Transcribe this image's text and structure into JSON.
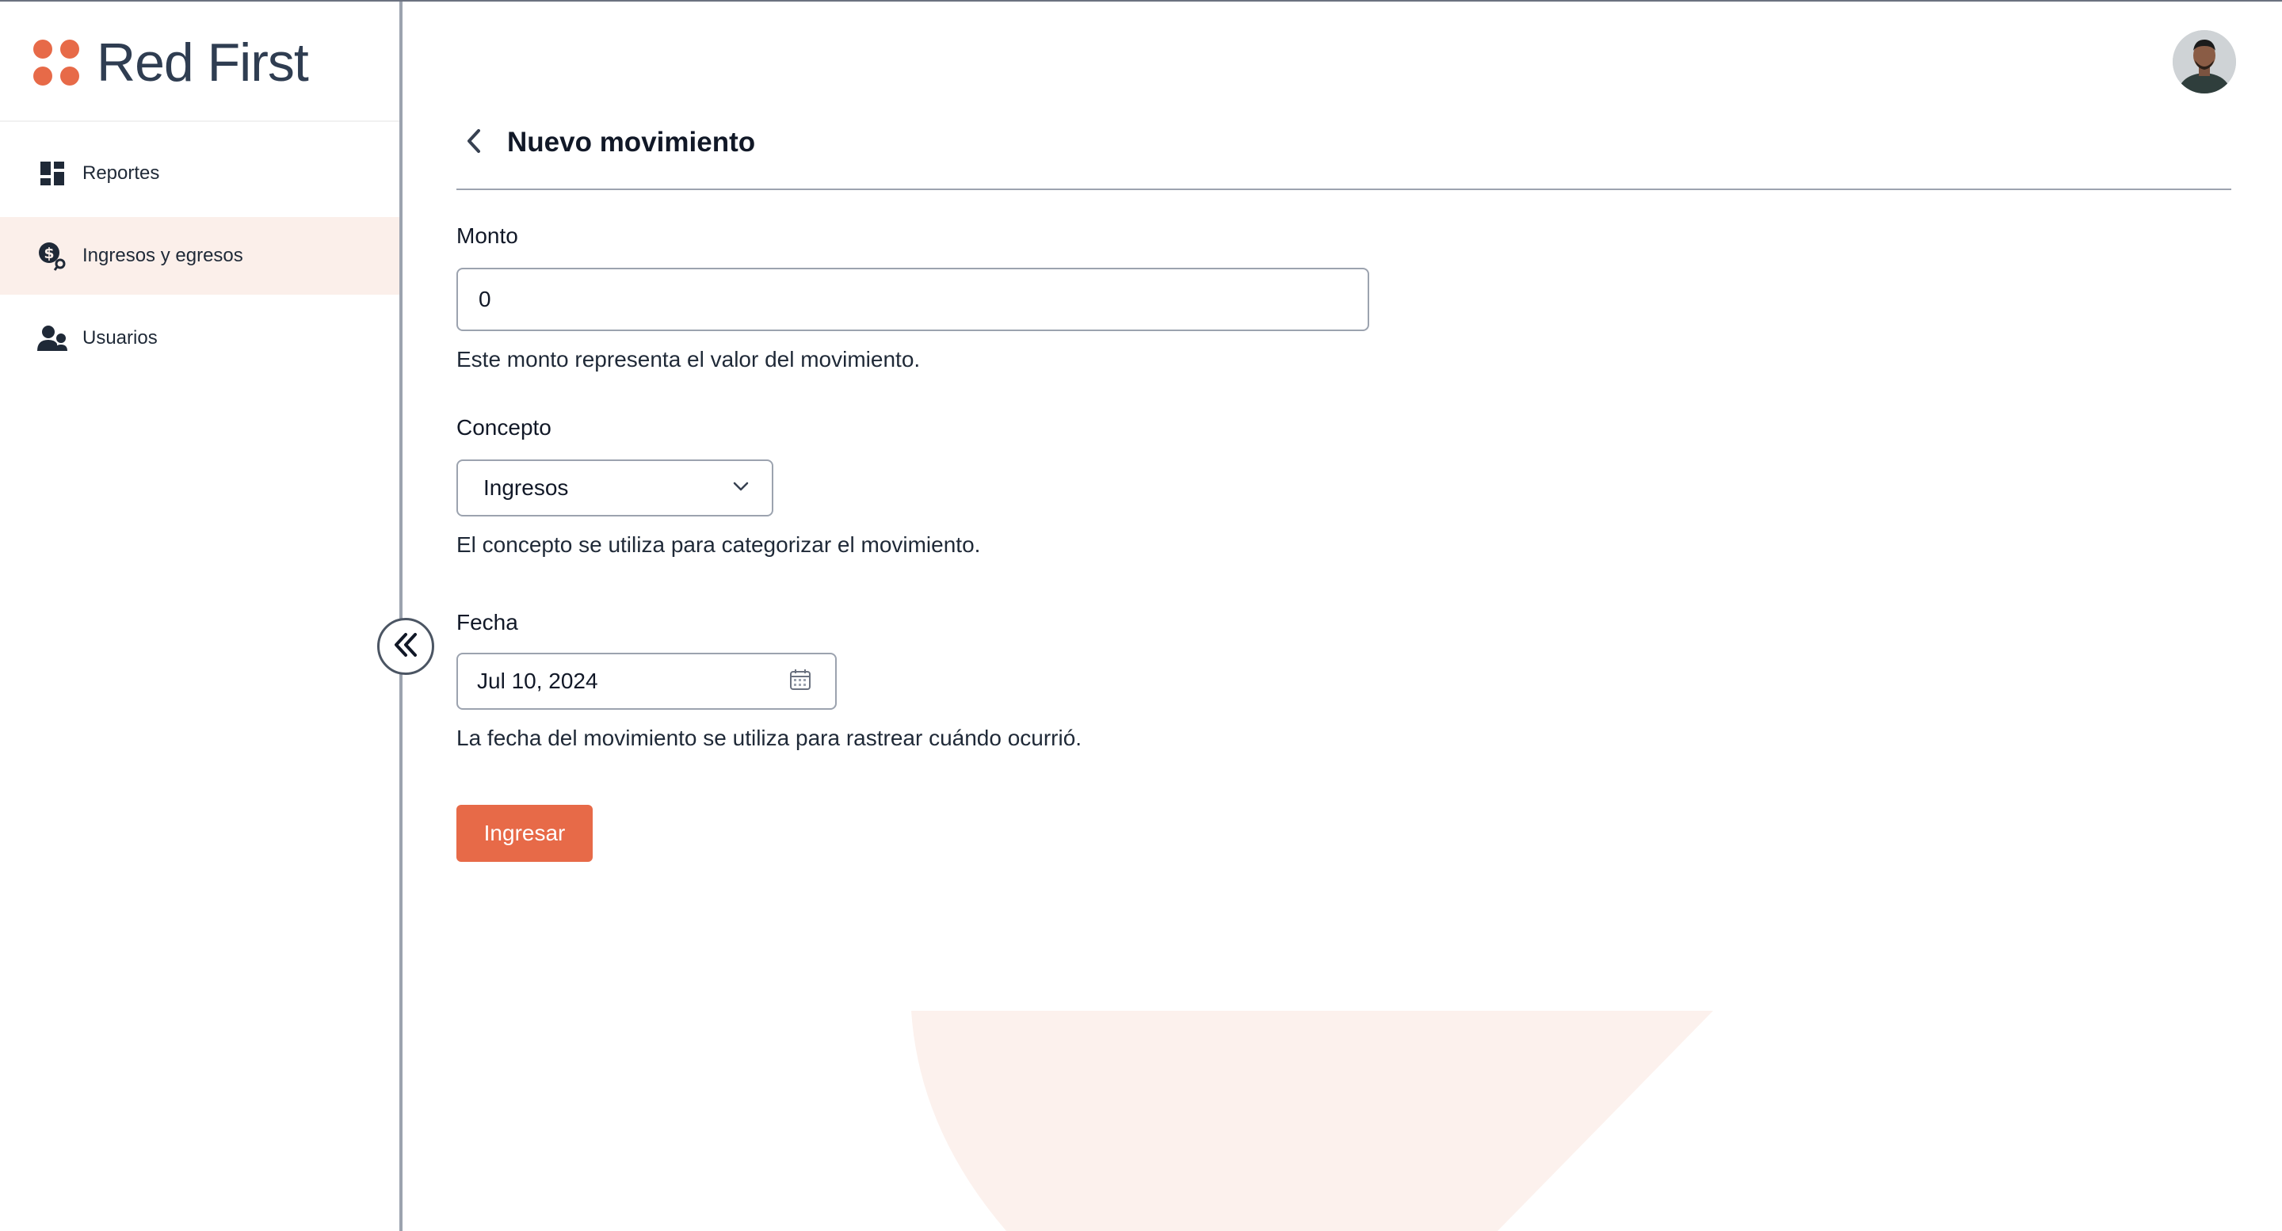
{
  "brand": {
    "name": "Red First"
  },
  "sidebar": {
    "items": [
      {
        "label": "Reportes",
        "icon": "dashboard-icon",
        "active": false
      },
      {
        "label": "Ingresos y egresos",
        "icon": "money-search-icon",
        "active": true
      },
      {
        "label": "Usuarios",
        "icon": "users-icon",
        "active": false
      }
    ],
    "collapse_icon": "double-chevron-left-icon"
  },
  "header": {
    "avatar": "user-avatar"
  },
  "page": {
    "title": "Nuevo movimiento",
    "back_icon": "chevron-left-icon"
  },
  "form": {
    "amount": {
      "label": "Monto",
      "value": "0",
      "help": "Este monto representa el valor del movimiento."
    },
    "concept": {
      "label": "Concepto",
      "selected": "Ingresos",
      "help": "El concepto se utiliza para categorizar el movimiento."
    },
    "date": {
      "label": "Fecha",
      "value": "Jul 10, 2024",
      "help": "La fecha del movimiento se utiliza para rastrear cuándo ocurrió."
    },
    "submit_label": "Ingresar"
  },
  "colors": {
    "accent": "#e76a48",
    "active_bg": "#fbefea",
    "brand_text": "#2f3d51",
    "decor": "#fcf1ed"
  }
}
